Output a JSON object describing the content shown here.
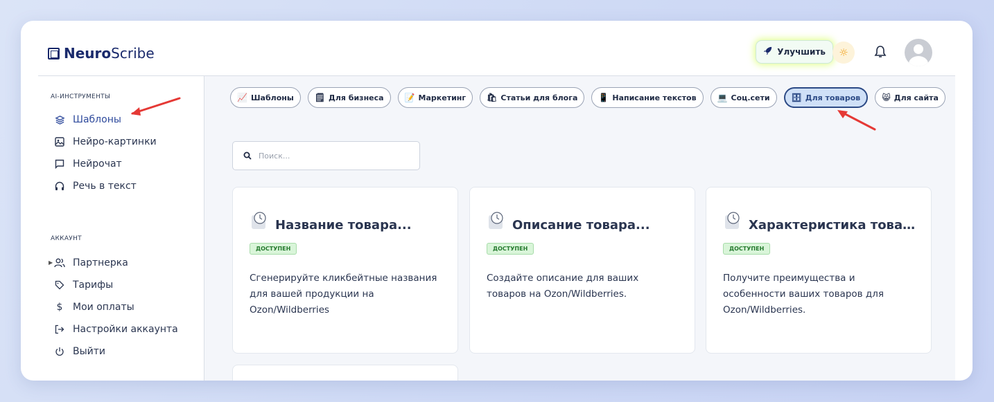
{
  "app": {
    "brand_bold": "Neuro",
    "brand_light": "Scribe"
  },
  "header": {
    "upgrade_label": "Улучшить"
  },
  "sidebar": {
    "section_tools": "AI-ИНСТРУМЕНТЫ",
    "tools": [
      {
        "label": "Шаблоны",
        "icon": "layers-icon"
      },
      {
        "label": "Нейро-картинки",
        "icon": "image-icon"
      },
      {
        "label": "Нейрочат",
        "icon": "chat-icon"
      },
      {
        "label": "Речь в текст",
        "icon": "headphones-icon"
      }
    ],
    "section_account": "АККАУНТ",
    "account": [
      {
        "label": "Партнерка",
        "icon": "users-icon"
      },
      {
        "label": "Тарифы",
        "icon": "tag-icon"
      },
      {
        "label": "Мои оплаты",
        "icon": "dollar-icon"
      },
      {
        "label": "Настройки аккаунта",
        "icon": "login-icon"
      },
      {
        "label": "Выйти",
        "icon": "power-icon"
      }
    ]
  },
  "categories": [
    {
      "emoji": "📈",
      "label": "Шаблоны"
    },
    {
      "emoji": "🗒",
      "label": "Для бизнеса"
    },
    {
      "emoji": "📝",
      "label": "Маркетинг"
    },
    {
      "emoji": "🛍",
      "label": "Статьи для блога"
    },
    {
      "emoji": "📱",
      "label": "Написание текстов"
    },
    {
      "emoji": "💻",
      "label": "Соц.сети"
    },
    {
      "emoji": "🗄",
      "label": "Для товаров"
    },
    {
      "emoji": "😸",
      "label": "Для сайта"
    }
  ],
  "search": {
    "placeholder": "Поиск..."
  },
  "cards": [
    {
      "title": "Название товара...",
      "badge": "ДОСТУПЕН",
      "desc": "Сгенерируйте кликбейтные названия для вашей продукции на Ozon/Wildberries"
    },
    {
      "title": "Описание товара...",
      "badge": "ДОСТУПЕН",
      "desc": "Создайте описание для ваших товаров на Ozon/Wildberries."
    },
    {
      "title": "Характеристика товар...",
      "badge": "ДОСТУПЕН",
      "desc": "Получите преимущества и особенности ваших товаров для Ozon/Wildberries."
    }
  ],
  "colors": {
    "accent": "#2c4a85",
    "arrow": "#e53935",
    "badge_bg": "#d9f5d9"
  }
}
